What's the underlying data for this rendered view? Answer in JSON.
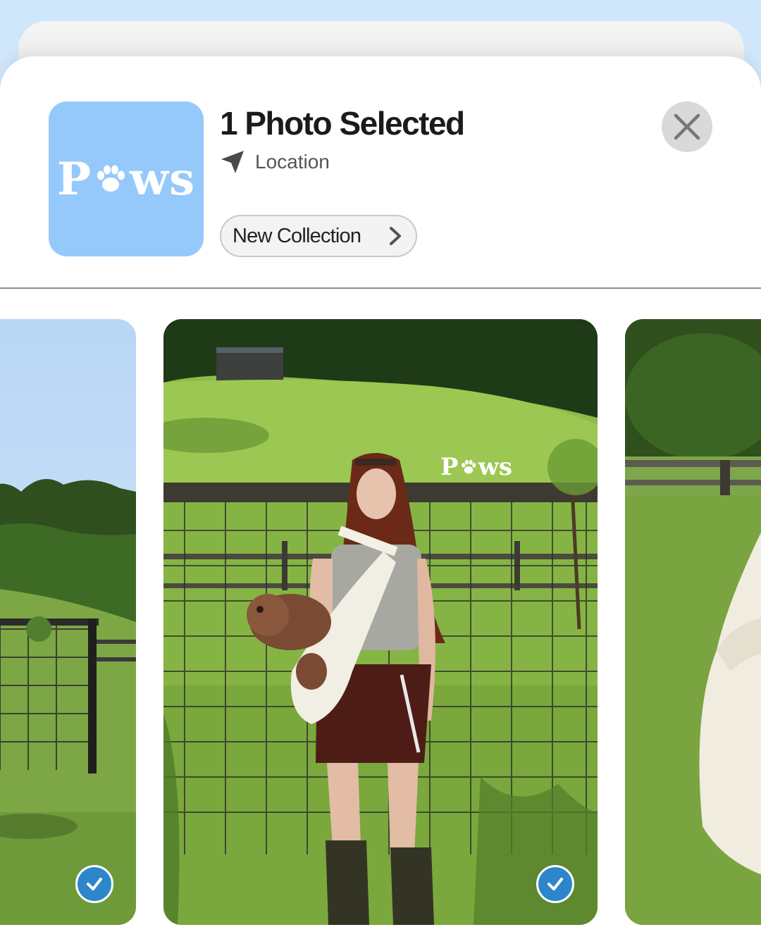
{
  "header": {
    "title": "1 Photo Selected",
    "location_label": "Location",
    "collection_label": "New Collection"
  },
  "app_icon": {
    "brand_left": "P",
    "brand_right": "ws"
  },
  "watermark": {
    "brand_left": "P",
    "brand_right": "ws"
  },
  "icons": {
    "close": "close-icon",
    "location": "location-arrow-icon",
    "chevron": "chevron-right-icon",
    "check": "checkmark-icon",
    "paw": "paw-icon"
  },
  "colors": {
    "background": "#cfe6fb",
    "app_icon": "#95c9fb",
    "check_badge": "#2c86c9",
    "close_button": "#d9d9d9"
  },
  "photos": [
    {
      "name": "photo-left",
      "selected": true
    },
    {
      "name": "photo-center",
      "selected": true
    },
    {
      "name": "photo-right",
      "selected": false
    }
  ]
}
